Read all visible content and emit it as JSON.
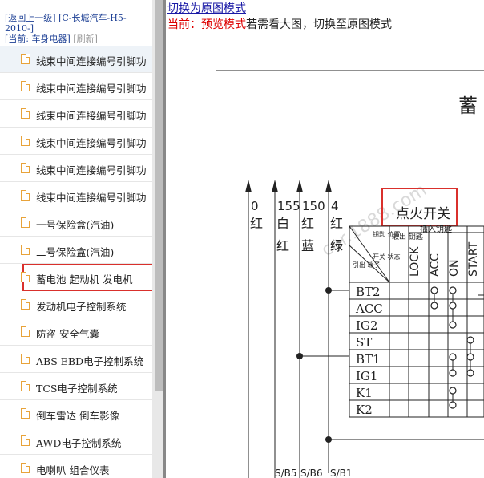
{
  "sidebar": {
    "back_link": "[返回上一级]",
    "category": "[C-长城汽车-H5-2010-]",
    "current_prefix": "[当前:",
    "current_value": "车身电器]",
    "refresh": "[刷新]",
    "items": [
      {
        "label": "线束中间连接编号引脚功"
      },
      {
        "label": "线束中间连接编号引脚功"
      },
      {
        "label": "线束中间连接编号引脚功"
      },
      {
        "label": "线束中间连接编号引脚功"
      },
      {
        "label": "线束中间连接编号引脚功"
      },
      {
        "label": "线束中间连接编号引脚功"
      },
      {
        "label": "一号保险盒(汽油)"
      },
      {
        "label": "二号保险盒(汽油)"
      },
      {
        "label": "蓄电池 起动机 发电机"
      },
      {
        "label": "发动机电子控制系统"
      },
      {
        "label": "防盗 安全气囊"
      },
      {
        "label": "ABS EBD电子控制系统"
      },
      {
        "label": "TCS电子控制系统"
      },
      {
        "label": "倒车雷达 倒车影像"
      },
      {
        "label": "AWD电子控制系统"
      },
      {
        "label": "电喇叭 组合仪表"
      }
    ]
  },
  "main": {
    "switch_link": "切换为原图模式",
    "mode_prefix": "当前：",
    "mode_name": "预览模式",
    "mode_hint": "若需看大图，切换至原图模式"
  },
  "diagram": {
    "title_partial": "蓄",
    "switch_title": "点火开关",
    "wires": [
      {
        "num": "0",
        "color": "红"
      },
      {
        "num": "155",
        "color": "白红"
      },
      {
        "num": "150",
        "color": "红蓝"
      },
      {
        "num": "4",
        "color": "红绿"
      }
    ],
    "header_diag_top": "钥匙 位置",
    "header_diag_right": "开关 状态",
    "header_diag_left": "引出 端子",
    "header_mid": "取出 钥匙",
    "header_insert": "插入钥匙",
    "positions": [
      "LOCK",
      "ACC",
      "ON",
      "START"
    ],
    "terminals": [
      "BT2",
      "ACC",
      "IG2",
      "ST",
      "BT1",
      "IG1",
      "K1",
      "K2"
    ],
    "bottom_labels": [
      "S/B5",
      "S/B6",
      "S/B1"
    ],
    "watermark": "car.1888.com"
  },
  "colors": {
    "highlight": "#d9302c",
    "link": "#1a1aa6",
    "mode_red": "#dd0000"
  }
}
